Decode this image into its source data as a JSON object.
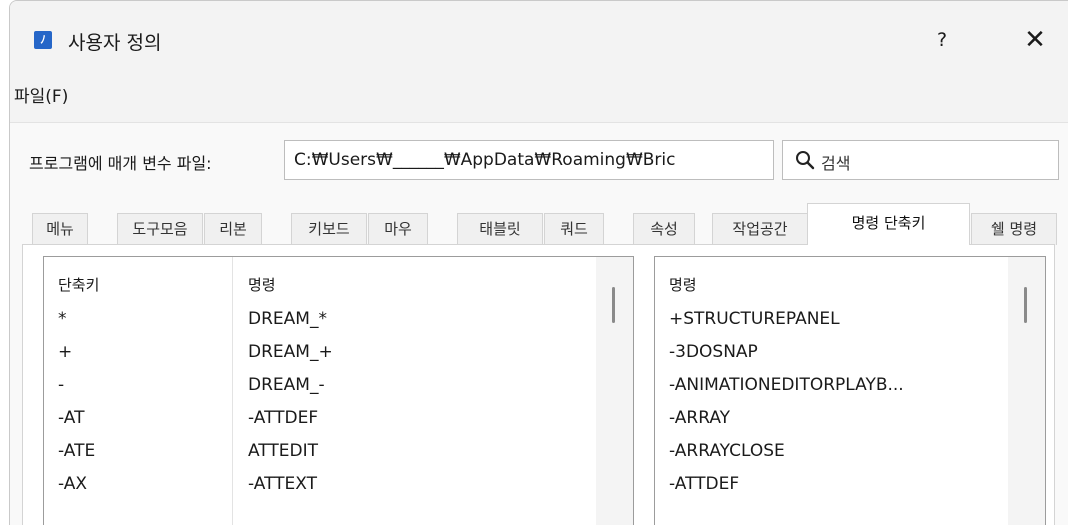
{
  "window": {
    "title": "사용자 정의",
    "app_icon_glyph": "ﾉ",
    "help_label": "?",
    "close_label": "✕"
  },
  "menubar": {
    "file_label": "파일(F)"
  },
  "path": {
    "label": "프로그램에 매개 변수 파일:",
    "value": "C:₩Users₩______₩AppData₩Roaming₩Bric"
  },
  "search": {
    "placeholder": "검색"
  },
  "tabs": [
    "메뉴",
    "도구모음",
    "리본",
    "키보드",
    "마우",
    "태블릿",
    "쿼드",
    "속성",
    "작업공간",
    "명령 단축키",
    "쉘 명령"
  ],
  "active_tab_index": 9,
  "shortcuts_table": {
    "headers": [
      "단축키",
      "명령"
    ],
    "rows": [
      [
        "*",
        "DREAM_*"
      ],
      [
        "+",
        "DREAM_+"
      ],
      [
        "-",
        "DREAM_-"
      ],
      [
        "-AT",
        "-ATTDEF"
      ],
      [
        "-ATE",
        "ATTEDIT"
      ],
      [
        "-AX",
        "-ATTEXT"
      ]
    ]
  },
  "commands_list": {
    "header": "명령",
    "items": [
      "+STRUCTUREPANEL",
      "-3DOSNAP",
      "-ANIMATIONEDITORPLAYB...",
      "-ARRAY",
      "-ARRAYCLOSE",
      "-ATTDEF"
    ]
  },
  "colors": {
    "accent": "#2566c8",
    "window_bg": "#f3f3f3",
    "border": "#9c9c9c"
  }
}
